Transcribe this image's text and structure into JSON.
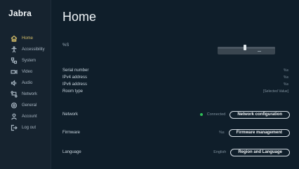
{
  "app": {
    "brand": "Jabra"
  },
  "sidebar": {
    "items": [
      {
        "label": "Home",
        "icon": "home-icon",
        "active": true
      },
      {
        "label": "Accessibility",
        "icon": "accessibility-icon"
      },
      {
        "label": "System",
        "icon": "system-icon"
      },
      {
        "label": "Video",
        "icon": "video-icon"
      },
      {
        "label": "Audio",
        "icon": "audio-icon"
      },
      {
        "label": "Network",
        "icon": "network-icon"
      },
      {
        "label": "General",
        "icon": "gear-icon"
      },
      {
        "label": "Account",
        "icon": "account-icon"
      },
      {
        "label": "Log out",
        "icon": "logout-icon"
      }
    ]
  },
  "main": {
    "title": "Home",
    "model": "%S",
    "info": [
      {
        "label": "Serial number",
        "value": "%s"
      },
      {
        "label": "IPv4 address",
        "value": "%s"
      },
      {
        "label": "IPv6 address",
        "value": "%s"
      },
      {
        "label": "Room type",
        "value": "[Selected Value]"
      }
    ],
    "network": {
      "label": "Network",
      "status": "Connected",
      "button": "Network configuration"
    },
    "firmware": {
      "label": "Firmware",
      "version": "%s",
      "button": "Firmware management"
    },
    "language": {
      "label": "Language",
      "value": "English",
      "button": "Region and Language"
    }
  },
  "colors": {
    "background": "#0f1e2a",
    "sidebar": "#16232f",
    "active": "#d8c06a",
    "connected": "#2fbf58"
  }
}
